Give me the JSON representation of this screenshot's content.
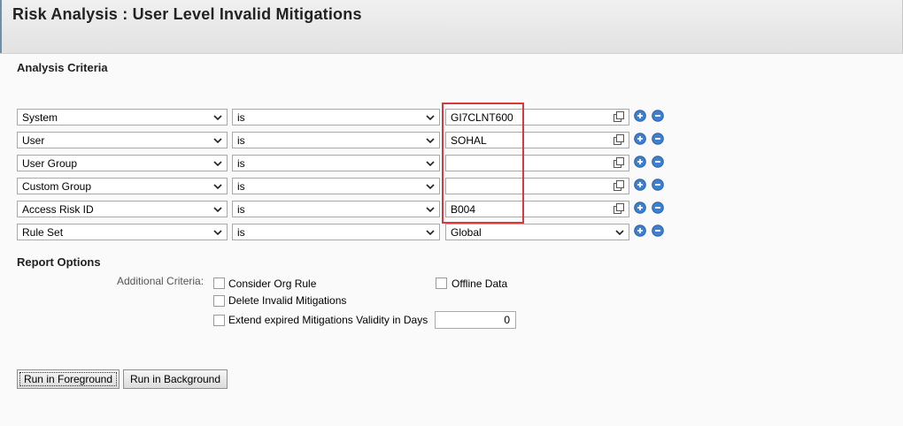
{
  "page": {
    "title": "Risk Analysis : User Level Invalid Mitigations"
  },
  "analysis": {
    "heading": "Analysis Criteria",
    "rows": [
      {
        "field": "System",
        "operator": "is",
        "value": "GI7CLNT600"
      },
      {
        "field": "User",
        "operator": "is",
        "value": "SOHAL"
      },
      {
        "field": "User Group",
        "operator": "is",
        "value": ""
      },
      {
        "field": "Custom Group",
        "operator": "is",
        "value": ""
      },
      {
        "field": "Access Risk ID",
        "operator": "is",
        "value": "B004"
      },
      {
        "field": "Rule Set",
        "operator": "is",
        "value": "Global"
      }
    ]
  },
  "report": {
    "heading": "Report Options",
    "additional_label": "Additional Criteria:",
    "consider_org_rule": "Consider Org Rule",
    "offline_data": "Offline Data",
    "delete_invalid": "Delete Invalid Mitigations",
    "extend_expired": "Extend expired Mitigations Validity in Days",
    "extend_days": "0"
  },
  "actions": {
    "run_foreground": "Run in Foreground",
    "run_background": "Run in Background"
  },
  "colors": {
    "highlight": "#d9383c",
    "add_button": "#3f7fd0",
    "remove_button": "#3f7fd0"
  },
  "icons": {
    "dropdown": "chevron-down-icon",
    "value_help": "value-help-icon",
    "add": "plus-circle-icon",
    "remove": "minus-circle-icon"
  }
}
